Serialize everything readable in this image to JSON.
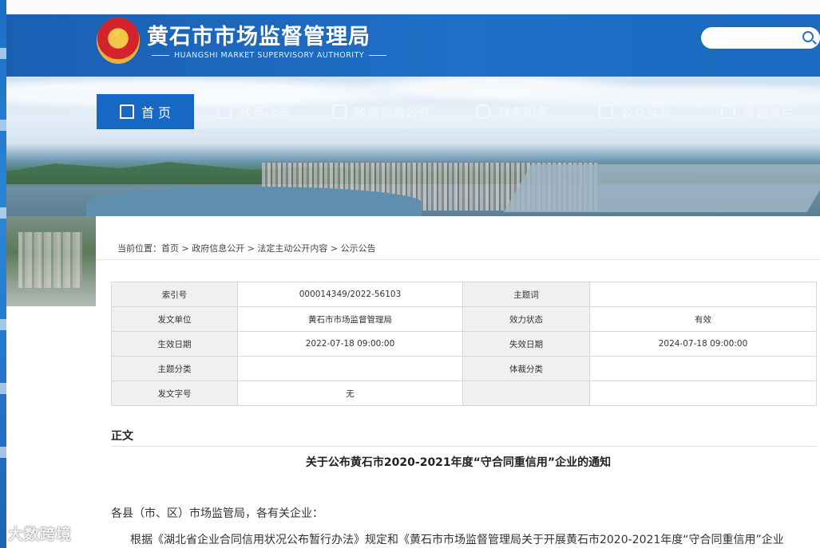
{
  "header": {
    "title": "黄石市市场监督管理局",
    "subtitle": "HUANGSHI MARKET SUPERVISORY AUTHORITY",
    "search": {
      "placeholder": "",
      "icon": "search-icon"
    }
  },
  "nav": {
    "items": [
      {
        "label": "首 页",
        "icon": "home-icon",
        "active": true
      },
      {
        "label": "政务动态",
        "icon": "document-icon",
        "active": false
      },
      {
        "label": "政府信息公开",
        "icon": "info-board-icon",
        "active": false
      },
      {
        "label": "政务服务",
        "icon": "service-chat-icon",
        "active": false
      },
      {
        "label": "公众互动",
        "icon": "bookmark-icon",
        "active": false
      },
      {
        "label": "专题专栏",
        "icon": "book-icon",
        "active": false
      }
    ]
  },
  "breadcrumb": "当前位置：首页 > 政府信息公开 > 法定主动公开内容 > 公示公告",
  "meta": {
    "rows": [
      {
        "k1": "索引号",
        "v1": "000014349/2022-56103",
        "k2": "主题词",
        "v2": ""
      },
      {
        "k1": "发文单位",
        "v1": "黄石市市场监督管理局",
        "k2": "效力状态",
        "v2": "有效"
      },
      {
        "k1": "生效日期",
        "v1": "2022-07-18 09:00:00",
        "k2": "失效日期",
        "v2": "2024-07-18 09:00:00"
      },
      {
        "k1": "主题分类",
        "v1": "",
        "k2": "体裁分类",
        "v2": ""
      },
      {
        "k1": "发文字号",
        "v1": "无",
        "k2": "",
        "v2": ""
      }
    ]
  },
  "body": {
    "section_label": "正文",
    "title": "关于公布黄石市2020-2021年度“守合同重信用”企业的通知",
    "para1": "各县（市、区）市场监管局，各有关企业：",
    "para2": "根据《湖北省企业合同信用状况公布暂行办法》规定和《黄石市市场监督管理局关于开展黄石市2020-2021年度“守合同重信用”企业"
  },
  "watermark": "大数跨境",
  "colors": {
    "header_blue": "#1e6fc6",
    "nav_active": "#1768c4"
  }
}
